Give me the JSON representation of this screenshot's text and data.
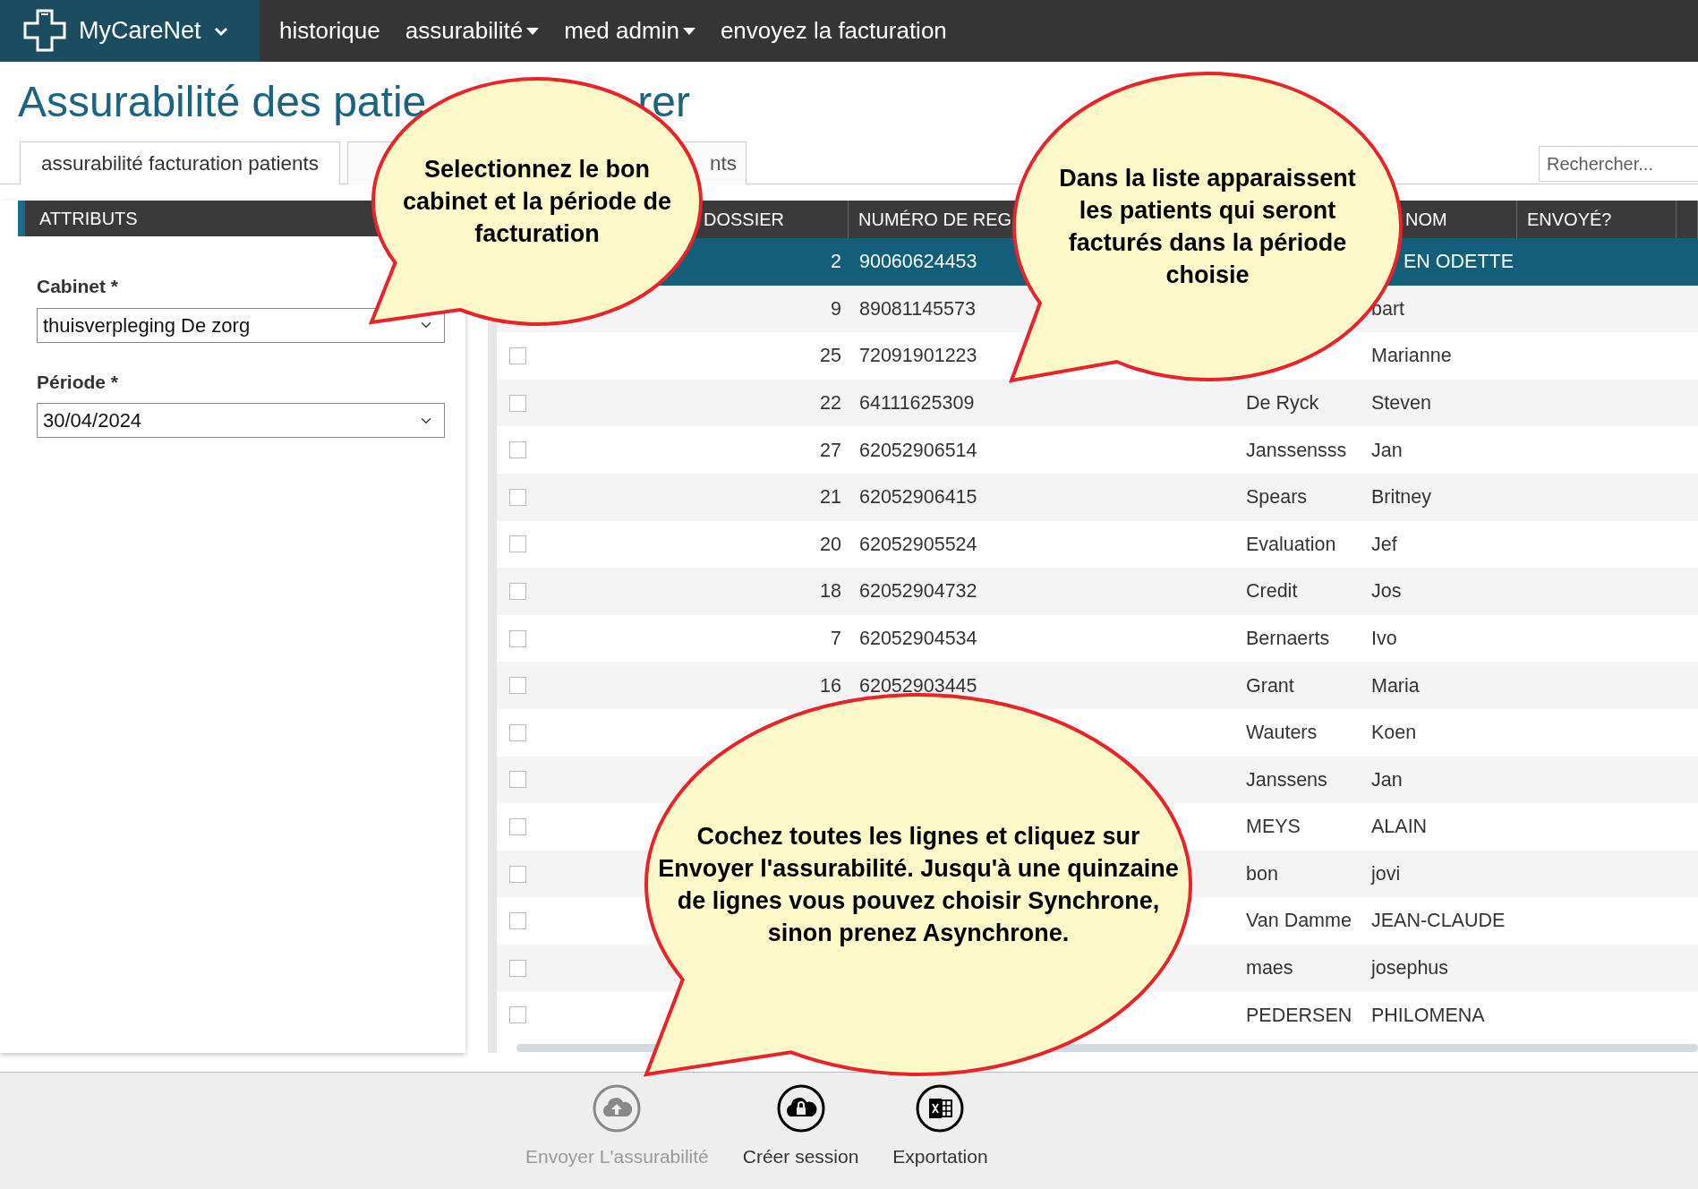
{
  "nav": {
    "brand": "MyCareNet",
    "items": [
      {
        "label": "historique",
        "dropdown": false
      },
      {
        "label": "assurabilité",
        "dropdown": true
      },
      {
        "label": "med admin",
        "dropdown": true
      },
      {
        "label": "envoyez la facturation",
        "dropdown": false
      }
    ]
  },
  "title_parts": [
    "Assurabilité des patie",
    "rer"
  ],
  "tabs": [
    {
      "label": "assurabilité facturation patients",
      "selected": true
    },
    {
      "label": "nts",
      "selected": false
    }
  ],
  "search": {
    "placeholder": "Rechercher..."
  },
  "attributes": {
    "header": "ATTRIBUTS",
    "fields": [
      {
        "label": "Cabinet *",
        "value": "thuisverpleging De zorg"
      },
      {
        "label": "Période *",
        "value": "30/04/2024"
      }
    ]
  },
  "table": {
    "headers": [
      "DOSSIER",
      "NUMÉRO DE REG",
      "NOM",
      "ENVOYÉ?"
    ],
    "rows": [
      {
        "selected": true,
        "dossier": "2",
        "numero": "90060624453",
        "prenom": "EN ODETTE"
      },
      {
        "selected": false,
        "dossier": "9",
        "numero": "89081145573",
        "prenom": "bart"
      },
      {
        "selected": false,
        "checked": false,
        "dossier": "25",
        "numero": "72091901223",
        "prenom": "Marianne"
      },
      {
        "selected": false,
        "checked": false,
        "dossier": "22",
        "numero": "64111625309",
        "nom": "De Ryck",
        "prenom": "Steven"
      },
      {
        "selected": false,
        "checked": false,
        "dossier": "27",
        "numero": "62052906514",
        "nom": "Janssensss",
        "prenom": "Jan"
      },
      {
        "selected": false,
        "checked": false,
        "dossier": "21",
        "numero": "62052906415",
        "nom": "Spears",
        "prenom": "Britney"
      },
      {
        "selected": false,
        "checked": false,
        "dossier": "20",
        "numero": "62052905524",
        "nom": "Evaluation",
        "prenom": "Jef"
      },
      {
        "selected": false,
        "checked": false,
        "dossier": "18",
        "numero": "62052904732",
        "nom": "Credit",
        "prenom": "Jos"
      },
      {
        "selected": false,
        "checked": false,
        "dossier": "7",
        "numero": "62052904534",
        "nom": "Bernaerts",
        "prenom": "Ivo"
      },
      {
        "selected": false,
        "checked": false,
        "dossier": "16",
        "numero": "62052903445",
        "nom": "Grant",
        "prenom": "Maria"
      },
      {
        "selected": false,
        "checked": false,
        "nom": "Wauters",
        "prenom": "Koen"
      },
      {
        "selected": false,
        "checked": false,
        "nom": "Janssens",
        "prenom": "Jan"
      },
      {
        "selected": false,
        "checked": false,
        "nom": "MEYS",
        "prenom": "ALAIN"
      },
      {
        "selected": false,
        "checked": false,
        "nom": "bon",
        "prenom": "jovi"
      },
      {
        "selected": false,
        "checked": false,
        "nom": "Van Damme",
        "prenom": "JEAN-CLAUDE"
      },
      {
        "selected": false,
        "checked": false,
        "nom": "maes",
        "prenom": "josephus"
      },
      {
        "selected": false,
        "checked": false,
        "nom": "PEDERSEN",
        "prenom": "PHILOMENA"
      }
    ]
  },
  "toolbar": [
    {
      "label": "Envoyer L'assurabilité",
      "kind": "upload",
      "disabled": true
    },
    {
      "label": "Créer session",
      "kind": "session",
      "disabled": false
    },
    {
      "label": "Exportation",
      "kind": "export",
      "disabled": false
    }
  ],
  "callouts": [
    {
      "text": "Selectionnez le bon cabinet et la période de facturation"
    },
    {
      "text": "Dans la liste apparaissent les patients qui seront facturés dans la période choisie"
    },
    {
      "text": "Cochez toutes les lignes et cliquez sur Envoyer l'assurabilité. Jusqu'à une quinzaine de lignes vous pouvez choisir Synchrone, sinon prenez Asynchrone."
    }
  ]
}
